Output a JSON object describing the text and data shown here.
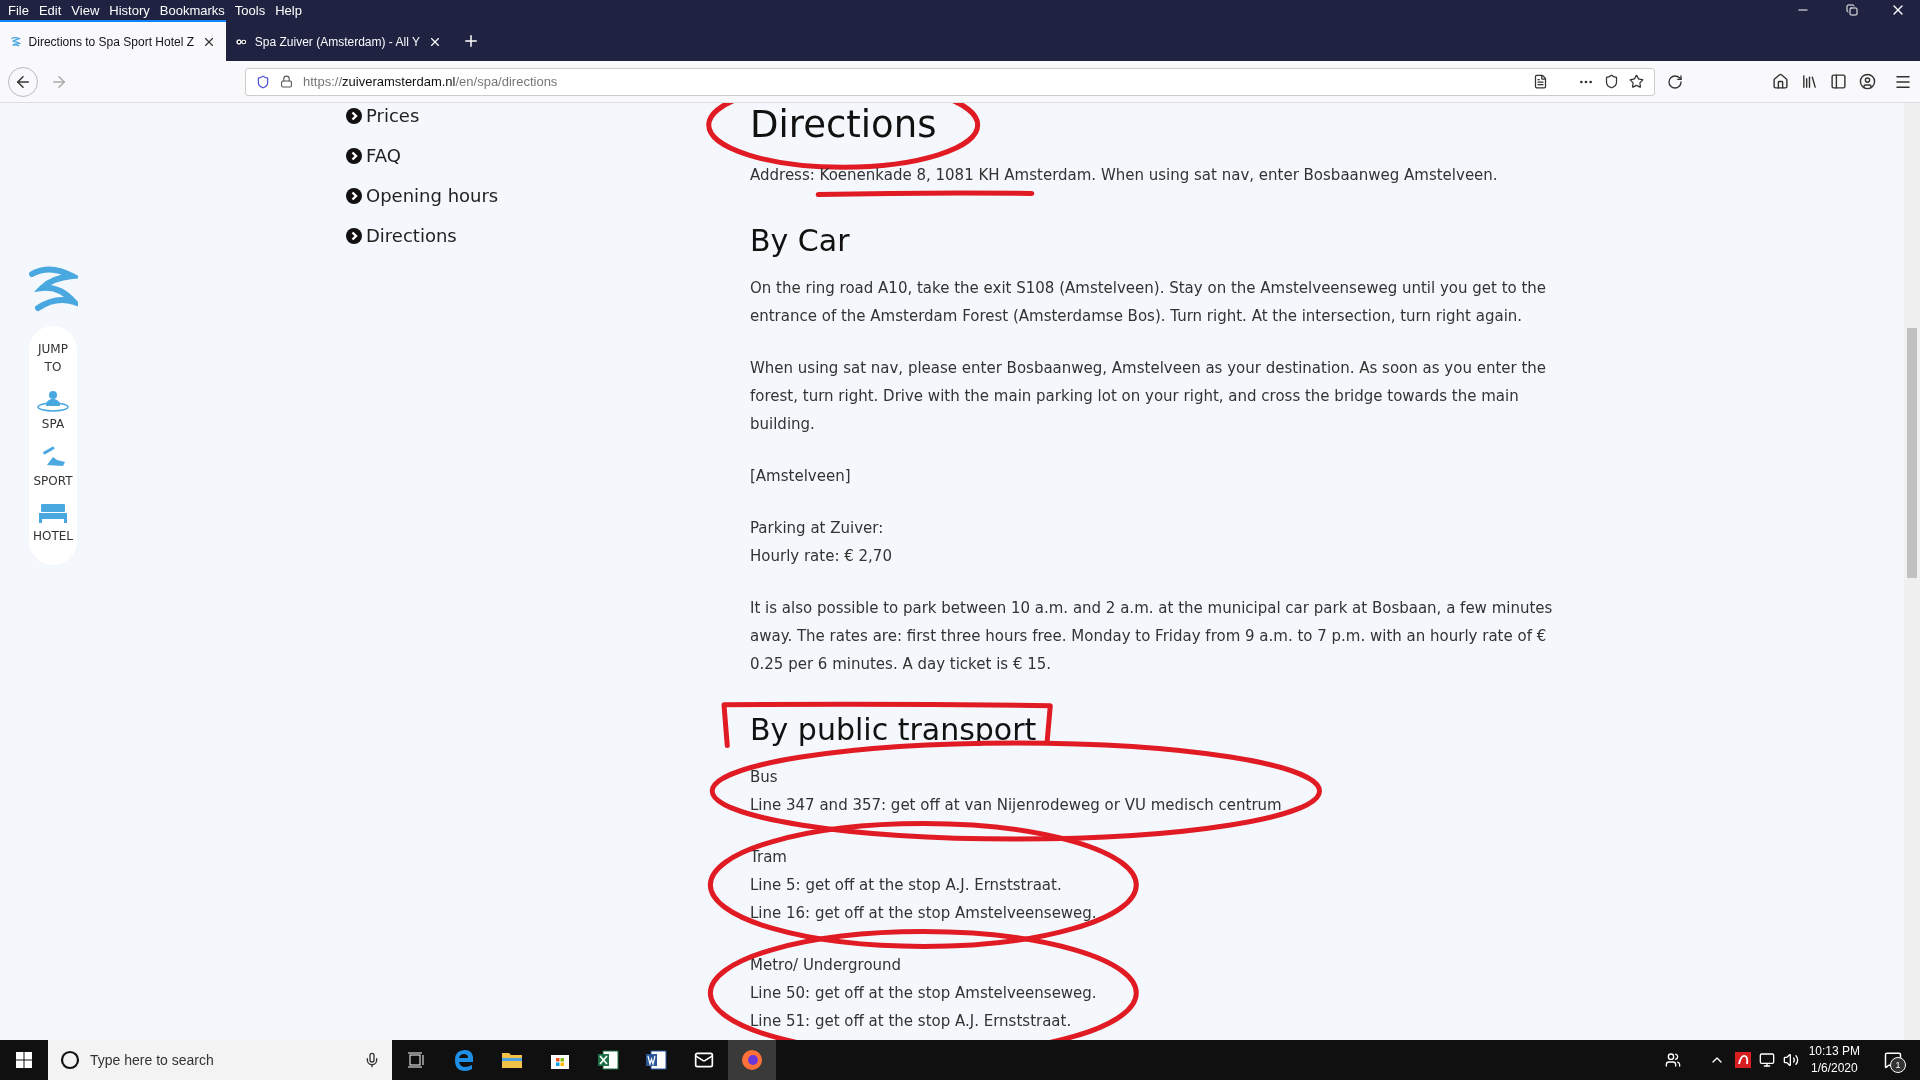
{
  "menu_bar": [
    "File",
    "Edit",
    "View",
    "History",
    "Bookmarks",
    "Tools",
    "Help"
  ],
  "tabs": [
    {
      "title": "Directions to Spa Sport Hotel Z",
      "kind": "zuiver",
      "selected": true
    },
    {
      "title": "Spa Zuiver (Amsterdam) - All Y",
      "kind": "owl",
      "selected": false
    }
  ],
  "address_bar": {
    "scheme": "https://",
    "host": "zuiveramsterdam.nl",
    "path": "/en/spa/directions"
  },
  "jump_bar": {
    "title": "JUMP TO",
    "items": [
      {
        "label": "SPA",
        "kind": "spa"
      },
      {
        "label": "SPORT",
        "kind": "sport"
      },
      {
        "label": "HOTEL",
        "kind": "hotel"
      }
    ]
  },
  "side_nav": [
    "Prices",
    "FAQ",
    "Opening hours",
    "Directions"
  ],
  "article": {
    "title": "Directions",
    "title_circled": true,
    "address_underlined": true,
    "address": "Address: Koenenkade 8, 1081 KH Amsterdam. When using sat nav, enter Bosbaanweg Amstelveen.",
    "sections": [
      {
        "heading": "By Car",
        "paragraphs": [
          {
            "lines": [
              "On the ring road A10, take the exit S108 (Amstelveen). Stay on the Amstelveenseweg until you get to the entrance of the Amsterdam Forest (Amsterdamse Bos). Turn right. At the intersection, turn right again."
            ]
          },
          {
            "lines": [
              "When using sat nav, please enter Bosbaanweg, Amstelveen as your destination. As soon as you enter the forest, turn right. Drive with the main parking lot on your right, and cross the bridge towards the main building."
            ]
          },
          {
            "lines": [
              "[Amstelveen]"
            ]
          },
          {
            "lines": [
              "Parking at Zuiver:",
              "Hourly rate: € 2,70"
            ]
          },
          {
            "lines": [
              "It is also possible to park between 10 a.m. and 2 a.m. at the municipal car park at Bosbaan, a few minutes away. The rates are: first three hours free. Monday to Friday from 9 a.m. to 7 p.m. with an hourly rate of € 0.25 per 6 minutes. A day ticket is € 15."
            ]
          }
        ]
      },
      {
        "heading": "By public transport",
        "heading_bracketed": true,
        "paragraphs": [
          {
            "circled": true,
            "lines": [
              "Bus",
              "Line 347 and 357: get off at van Nijenrodeweg or VU medisch centrum"
            ]
          },
          {
            "circled": true,
            "lines": [
              "Tram",
              "Line 5: get off at the stop A.J. Ernststraat.",
              "Line 16: get off at the stop Amstelveenseweg."
            ]
          },
          {
            "circled": true,
            "lines": [
              "Metro/ Underground",
              "Line 50: get off at the stop Amstelveenseweg.",
              "Line 51: get off at the stop A.J. Ernststraat."
            ]
          }
        ]
      }
    ]
  },
  "taskbar": {
    "search_placeholder": "Type here to search",
    "time": "10:13 PM",
    "date": "1/6/2020",
    "notifications": "1"
  }
}
